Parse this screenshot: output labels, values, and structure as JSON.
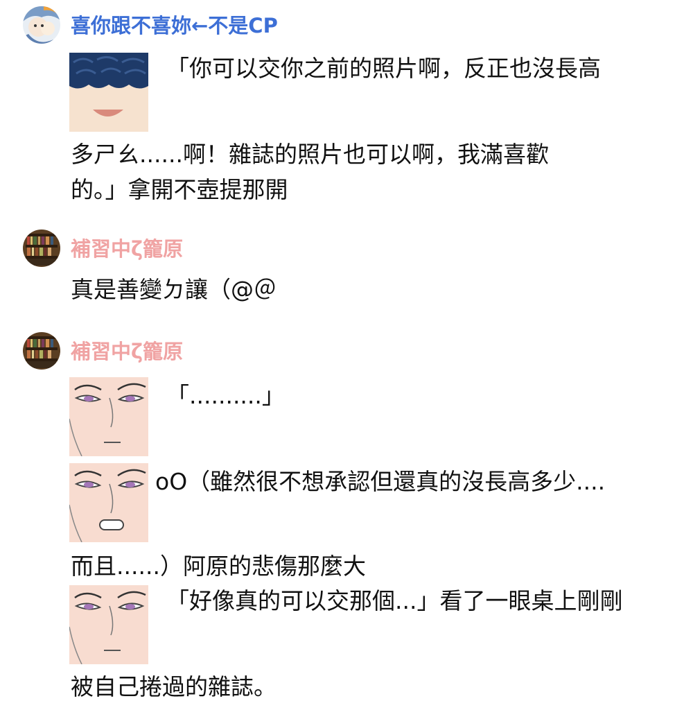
{
  "messages": [
    {
      "sender": "喜你跟不喜妳←不是CP",
      "lines": [
        "「你可以交你之前的照片啊，反正也沒長高",
        "多ㄕㄠ......啊！雜誌的照片也可以啊，我滿喜歡",
        "的。」拿開不壺提那開"
      ]
    },
    {
      "sender": "補習中ζ籠原",
      "lines": [
        "真是善變ㄉ讓（@＠"
      ]
    },
    {
      "sender": "補習中ζ籠原",
      "lines": [
        "「..........」",
        "oO（雖然很不想承認但還真的沒長高多少....",
        "而且......）阿原的悲傷那麼大",
        "「好像真的可以交那個...」看了一眼桌上剛剛",
        "被自己捲過的雜誌。"
      ]
    }
  ],
  "icons": {
    "avatar_1": "cartoon-character-avatar",
    "avatar_2": "bookshelf-avatar",
    "sticker_1": "blue-hair-smiling-face-sticker",
    "sticker_2": "pale-face-serious-sticker",
    "sticker_3": "pale-face-mouth-open-sticker",
    "sticker_4": "pale-face-serious-sticker"
  },
  "colors": {
    "name_blue": "#3d6fd6",
    "name_pink": "#f0a3a3",
    "text": "#111111"
  }
}
